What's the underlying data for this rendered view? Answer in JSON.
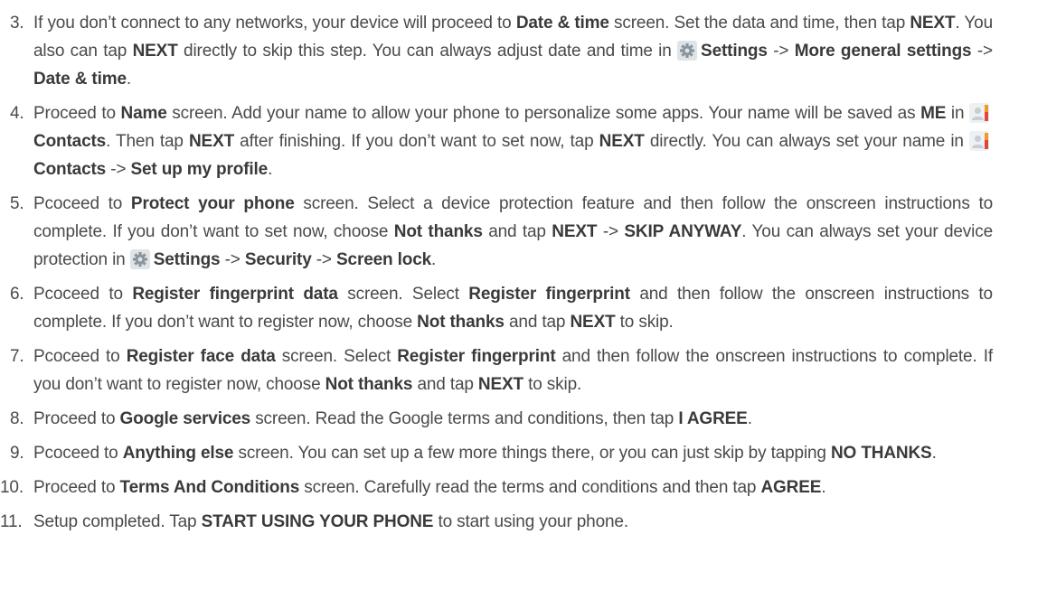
{
  "steps": [
    {
      "number": "3.",
      "parts": [
        {
          "t": "If you don’t connect to any networks, your device will proceed to "
        },
        {
          "t": "Date & time",
          "b": true
        },
        {
          "t": " screen. Set the data and time, then tap "
        },
        {
          "t": "NEXT",
          "b": true
        },
        {
          "t": ". You also can tap "
        },
        {
          "t": "NEXT",
          "b": true
        },
        {
          "t": " directly to skip this step. You can always adjust date and time in "
        },
        {
          "icon": "settings-gear-icon"
        },
        {
          "t": "Settings",
          "b": true
        },
        {
          "t": " -> "
        },
        {
          "t": "More general settings",
          "b": true
        },
        {
          "t": " -> "
        },
        {
          "t": "Date & time",
          "b": true
        },
        {
          "t": "."
        }
      ]
    },
    {
      "number": "4.",
      "parts": [
        {
          "t": "Proceed to "
        },
        {
          "t": "Name",
          "b": true
        },
        {
          "t": " screen. Add your name to allow your phone to personalize some apps. Your name will be saved as "
        },
        {
          "t": "ME",
          "b": true
        },
        {
          "t": " in "
        },
        {
          "icon": "contacts-icon"
        },
        {
          "t": "Contacts",
          "b": true
        },
        {
          "t": ". Then tap "
        },
        {
          "t": "NEXT",
          "b": true
        },
        {
          "t": " after finishing. If you don’t want to set now, tap "
        },
        {
          "t": "NEXT",
          "b": true
        },
        {
          "t": " directly. You can always set your name in "
        },
        {
          "icon": "contacts-icon"
        },
        {
          "t": "Contacts",
          "b": true
        },
        {
          "t": " -> "
        },
        {
          "t": "Set up my profile",
          "b": true
        },
        {
          "t": "."
        }
      ]
    },
    {
      "number": "5.",
      "parts": [
        {
          "t": "Pcoceed to "
        },
        {
          "t": "Protect your phone",
          "b": true
        },
        {
          "t": " screen. Select a device protection feature and then follow the onscreen instructions to complete. If you don’t want to set now, choose "
        },
        {
          "t": "Not thanks",
          "b": true
        },
        {
          "t": " and tap "
        },
        {
          "t": "NEXT",
          "b": true
        },
        {
          "t": " -> "
        },
        {
          "t": "SKIP ANYWAY",
          "b": true
        },
        {
          "t": ". You can always set your device protection in "
        },
        {
          "icon": "settings-gear-icon"
        },
        {
          "t": "Settings",
          "b": true
        },
        {
          "t": " -> "
        },
        {
          "t": "Security",
          "b": true
        },
        {
          "t": " -> "
        },
        {
          "t": "Screen lock",
          "b": true
        },
        {
          "t": "."
        }
      ]
    },
    {
      "number": "6.",
      "parts": [
        {
          "t": "Pcoceed to "
        },
        {
          "t": "Register fingerprint data",
          "b": true
        },
        {
          "t": " screen. Select "
        },
        {
          "t": "Register fingerprint",
          "b": true
        },
        {
          "t": " and then follow the onscreen instructions to complete. If you don’t want to register now, choose "
        },
        {
          "t": "Not thanks",
          "b": true
        },
        {
          "t": " and tap "
        },
        {
          "t": "NEXT",
          "b": true
        },
        {
          "t": " to skip."
        }
      ]
    },
    {
      "number": "7.",
      "parts": [
        {
          "t": "Pcoceed to "
        },
        {
          "t": "Register face data",
          "b": true
        },
        {
          "t": " screen. Select "
        },
        {
          "t": "Register fingerprint",
          "b": true
        },
        {
          "t": " and then follow the onscreen instructions to complete. If you don’t want to register now, choose "
        },
        {
          "t": "Not thanks",
          "b": true
        },
        {
          "t": " and tap "
        },
        {
          "t": "NEXT",
          "b": true
        },
        {
          "t": " to skip."
        }
      ]
    },
    {
      "number": "8.",
      "parts": [
        {
          "t": "Proceed to "
        },
        {
          "t": "Google services",
          "b": true
        },
        {
          "t": " screen. Read the Google terms and conditions, then tap "
        },
        {
          "t": "I AGREE",
          "b": true
        },
        {
          "t": "."
        }
      ]
    },
    {
      "number": "9.",
      "parts": [
        {
          "t": "Pcoceed to "
        },
        {
          "t": "Anything else",
          "b": true
        },
        {
          "t": " screen. You can set up a few more things there, or you can just skip by tapping "
        },
        {
          "t": "NO THANKS",
          "b": true
        },
        {
          "t": "."
        }
      ]
    },
    {
      "number": "10.",
      "parts": [
        {
          "t": "Proceed to "
        },
        {
          "t": "Terms And Conditions",
          "b": true
        },
        {
          "t": " screen. Carefully read the terms and conditions and then tap "
        },
        {
          "t": "AGREE",
          "b": true
        },
        {
          "t": "."
        }
      ]
    },
    {
      "number": "11.",
      "parts": [
        {
          "t": "Setup completed. Tap "
        },
        {
          "t": "START USING YOUR PHONE",
          "b": true
        },
        {
          "t": " to start using your phone."
        }
      ]
    }
  ],
  "colors": {
    "text": "#4a4a4a",
    "bold": "#3a3a3a",
    "icon_gear_bg": "#dfe4e8",
    "icon_contacts_bg": "#eef1f3",
    "icon_contacts_accent": "#f19a2a"
  }
}
